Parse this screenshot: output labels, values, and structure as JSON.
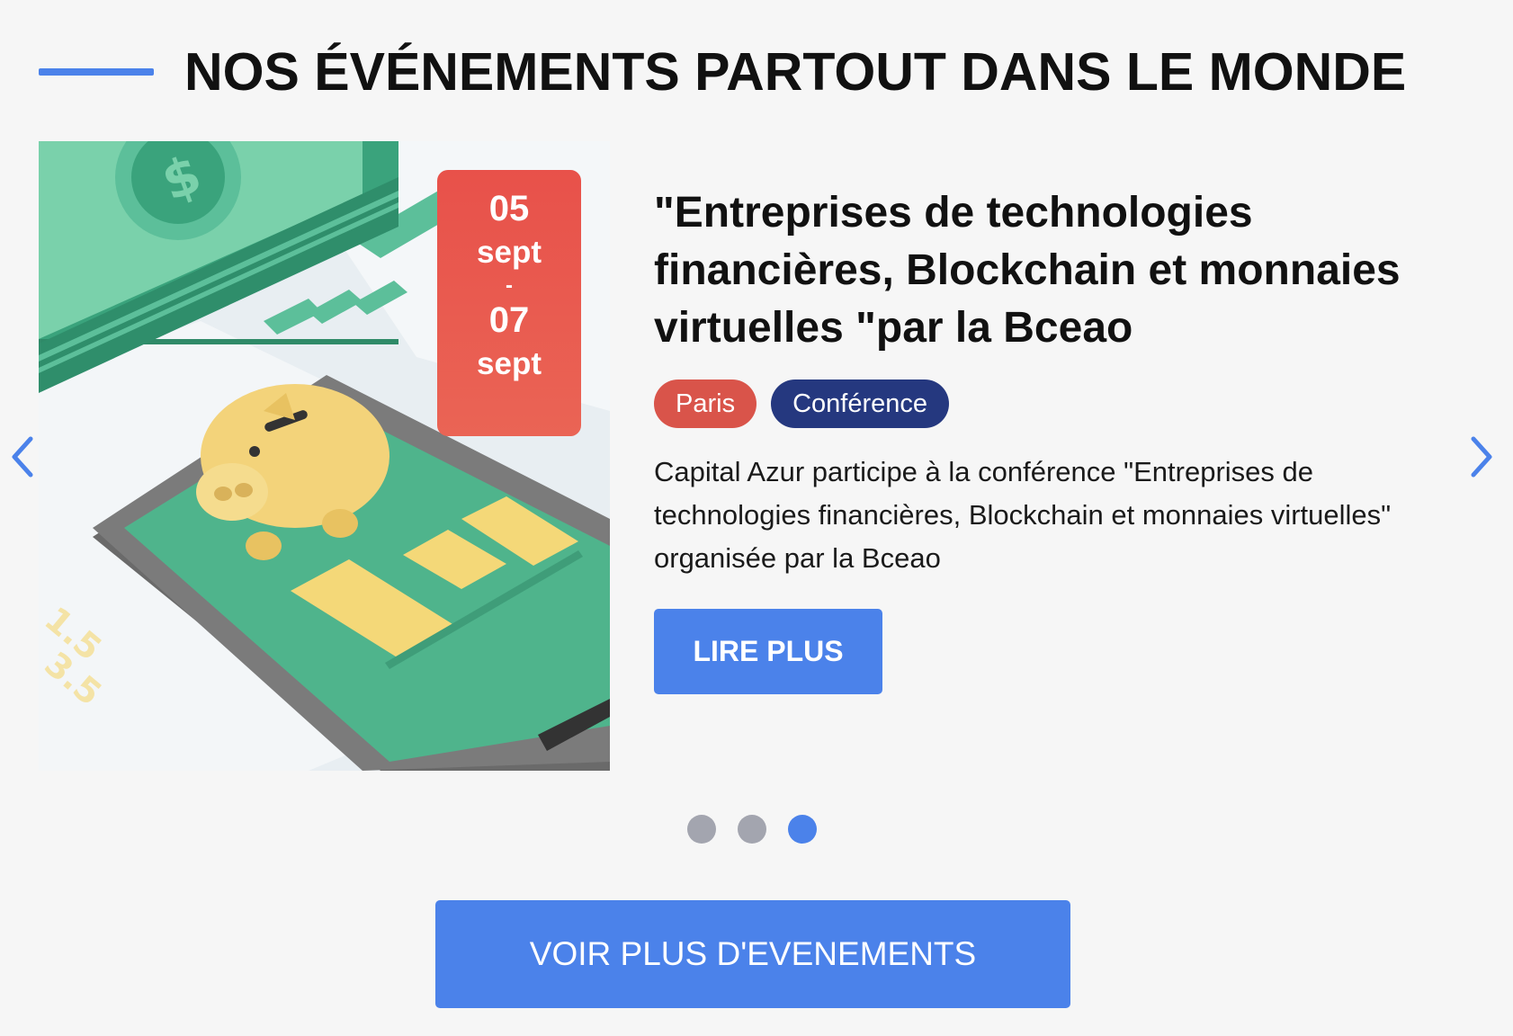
{
  "section": {
    "title": "NOS ÉVÉNEMENTS PARTOUT DANS LE MONDE"
  },
  "event": {
    "date_start_day": "05",
    "date_start_month": "sept",
    "date_separator": "-",
    "date_end_day": "07",
    "date_end_month": "sept",
    "title": "\"Entreprises de technologies financières, Blockchain et monnaies virtuelles \"par la Bceao",
    "tag_city": "Paris",
    "tag_type": "Conférence",
    "description": "Capital Azur participe à la conférence \"Entreprises de technologies financières, Blockchain et monnaies virtuelles\" organisée par la Bceao",
    "read_more_label": "LIRE PLUS",
    "image_icon": "fintech-piggy-bank-illustration"
  },
  "carousel": {
    "prev_icon": "chevron-left-icon",
    "next_icon": "chevron-right-icon",
    "dot_count": 3,
    "active_dot": 3
  },
  "footer": {
    "more_events_label": "VOIR PLUS D'EVENEMENTS"
  },
  "colors": {
    "accent": "#4b82ea",
    "date_badge": "#e8514a",
    "tag_city": "#d9544a",
    "tag_type": "#25387f"
  }
}
